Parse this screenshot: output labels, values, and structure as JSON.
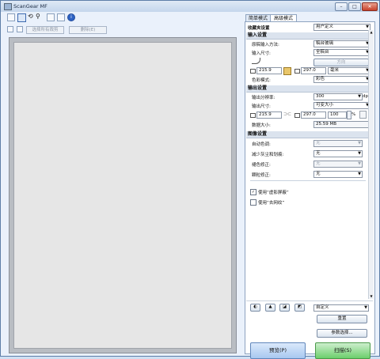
{
  "window": {
    "title": "ScanGear MF",
    "minimize": "–",
    "maximize": "□",
    "close": "✕"
  },
  "toolbar": {
    "icons": [
      "crop-icon",
      "select-icon",
      "rotate-icon",
      "zoom-icon",
      "fit-icon",
      "delete-icon",
      "info-icon"
    ]
  },
  "toolbar2": {
    "select_all_label": "选择所有裁剪",
    "delete_label": "删除(E)"
  },
  "tabs": {
    "basic": "简单模式",
    "advanced": "高级模式"
  },
  "favorite": {
    "label": "收藏夹设置",
    "value": "用户定义"
  },
  "input": {
    "section": "输入设置",
    "source_label": "原稿输入方法:",
    "source_value": "稿台玻璃",
    "size_label": "输入尺寸:",
    "size_value": "全稿台",
    "direction_label": "方向",
    "width": "215.9",
    "height": "297.0",
    "unit": "毫米",
    "color_label": "色彩模式:",
    "color_value": "彩色"
  },
  "output": {
    "section": "输出设置",
    "res_label": "输出分辨率:",
    "res_value": "300",
    "res_unit": "dpi",
    "size_label": "输出尺寸:",
    "size_value": "可变大小",
    "width": "215.9",
    "height": "297.0",
    "scale": "100",
    "scale_unit": "%",
    "datasize_label": "数据大小:",
    "datasize_value": "25.59 MB"
  },
  "image": {
    "section": "图像设置",
    "rows": [
      {
        "label": "自动色调:",
        "value": "无",
        "disabled": true
      },
      {
        "label": "减少灰尘和划痕:",
        "value": "无",
        "disabled": false
      },
      {
        "label": "褪色修正:",
        "value": "无",
        "disabled": true
      },
      {
        "label": "颗粒修正:",
        "value": "无",
        "disabled": false
      }
    ],
    "unsharp_label": "使用“虚影屏蔽”",
    "unsharp_checked": true,
    "moire_label": "使用“去网纹”",
    "moire_checked": false
  },
  "bottom": {
    "tone_value": "自定义",
    "reset_label": "重置",
    "prefs_label": "参数选择...",
    "preview_label": "预览(P)",
    "scan_label": "扫描(S)"
  }
}
